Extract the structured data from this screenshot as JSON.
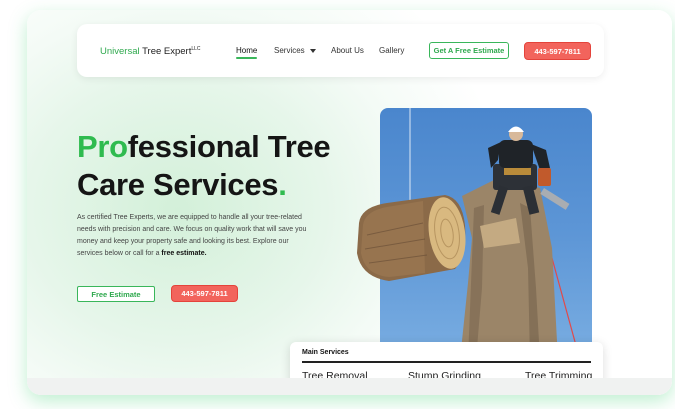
{
  "nav": {
    "logo_green": "Universal",
    "logo_rest": " Tree Expert",
    "logo_suffix": "LLC",
    "links": [
      "Home",
      "Services",
      "About Us",
      "Gallery"
    ],
    "cta_estimate": "Get A Free Estimate",
    "cta_phone": "443-597-7811"
  },
  "hero": {
    "title_green": "Pro",
    "title_line1_rest": "fessional Tree",
    "title_line2": "Care Services",
    "title_dot": ".",
    "description": "As certified Tree Experts, we are equipped to handle all your tree-related needs with precision and care. We focus on quality work that will save you money and keep your property safe and looking its best. Explore our services below or call for a ",
    "description_bold": "free estimate.",
    "btn_estimate": "Free Estimate",
    "btn_phone": "443-597-7811"
  },
  "services": {
    "title": "Main Services",
    "items": [
      "Tree Removal",
      "Stump Grinding",
      "Tree Trimming"
    ]
  },
  "colors": {
    "accent_green": "#2fbb4f",
    "cta_red": "#f2645c"
  }
}
